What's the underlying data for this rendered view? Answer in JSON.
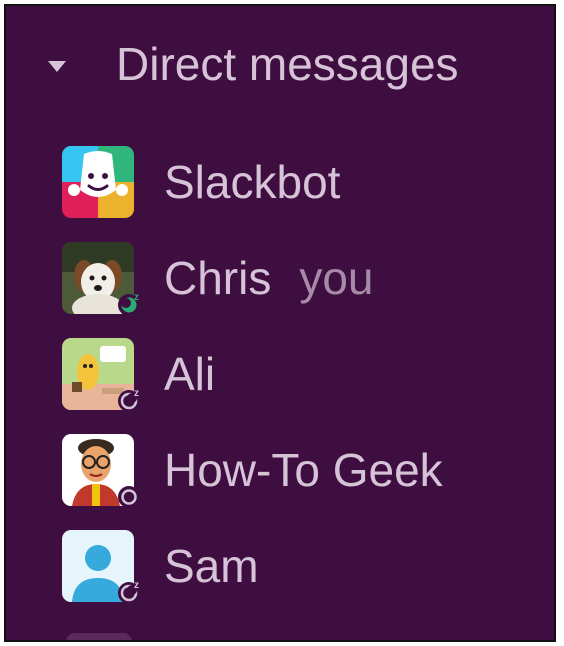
{
  "section": {
    "title": "Direct messages",
    "caret_icon": "caret-down-icon"
  },
  "direct_messages": [
    {
      "name": "Slackbot",
      "suffix": "",
      "status": "none",
      "avatar": "slackbot-avatar"
    },
    {
      "name": "Chris",
      "suffix": "you",
      "status": "away-snooze",
      "avatar": "dog-photo-avatar"
    },
    {
      "name": "Ali",
      "suffix": "",
      "status": "away-snooze",
      "avatar": "cartoon-avatar"
    },
    {
      "name": "How-To Geek",
      "suffix": "",
      "status": "offline",
      "avatar": "cartoon-glasses-avatar"
    },
    {
      "name": "Sam",
      "suffix": "",
      "status": "away-snooze",
      "avatar": "default-person-avatar"
    }
  ],
  "colors": {
    "sidebar_bg": "#3f0e40",
    "text": "#d6c3d7",
    "muted_text": "#a68aa7",
    "status_active": "#2bac76"
  }
}
